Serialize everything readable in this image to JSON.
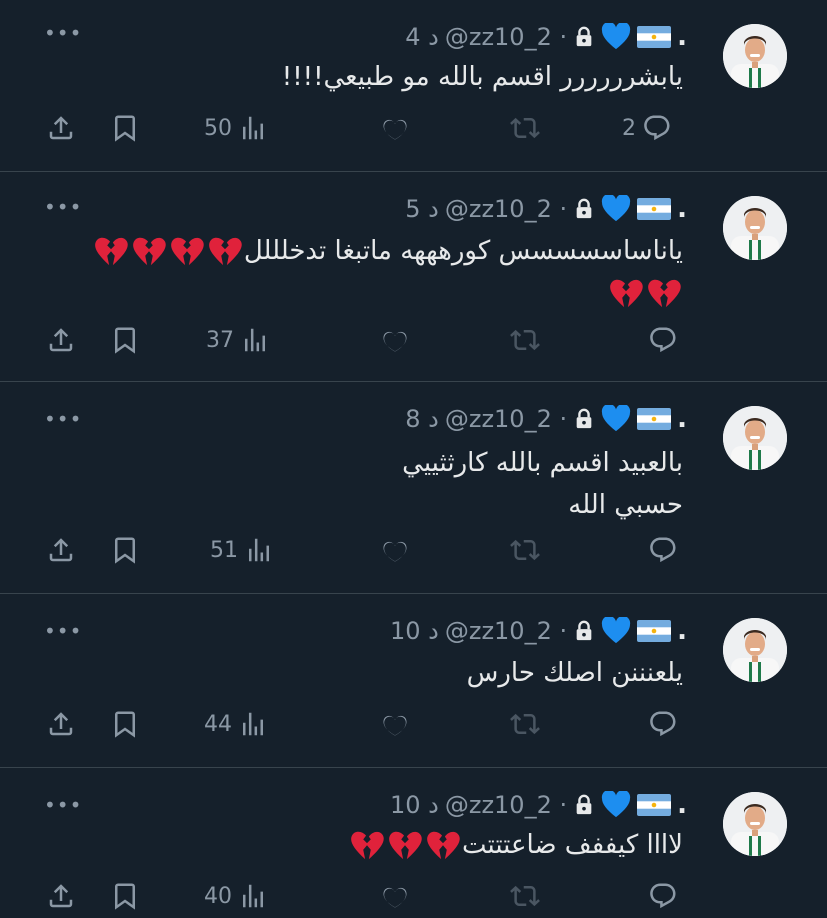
{
  "colors": {
    "background": "#15202b",
    "text": "#e7e9ea",
    "muted": "#8b98a5",
    "divider": "#38444d",
    "heart_blue": "#1d8ef0",
    "broken_heart": "#e0223b"
  },
  "header_common": {
    "handle": "@zz10_2 ·",
    "dot": "."
  },
  "tweets": [
    {
      "time": "4 د",
      "text": "يابشرررررر اقسم بالله مو طبيعي!!!!",
      "views": "50",
      "replies": "2"
    },
    {
      "time": "5 د",
      "text": "ياناساسسسسس كورهههه ماتبغا تدخلللل",
      "views": "37",
      "replies": ""
    },
    {
      "time": "8 د",
      "text_line1": "بالعبيد اقسم بالله كارثثييي",
      "text_line2": "حسبي الله",
      "views": "51",
      "replies": ""
    },
    {
      "time": "10 د",
      "text": "يلعنننن اصلك حارس",
      "views": "44",
      "replies": ""
    },
    {
      "time": "10 د",
      "text": "لاااا كيففف ضاعتتتت",
      "views": "40",
      "replies": ""
    }
  ],
  "icons": {
    "more": "more-icon",
    "reply": "reply-icon",
    "retweet": "retweet-icon",
    "like": "like-icon",
    "views": "views-icon",
    "bookmark": "bookmark-icon",
    "share": "share-icon",
    "lock": "lock-icon",
    "blue_heart": "blue-heart-emoji",
    "flag": "argentina-flag-emoji",
    "broken_heart": "broken-heart-emoji"
  }
}
